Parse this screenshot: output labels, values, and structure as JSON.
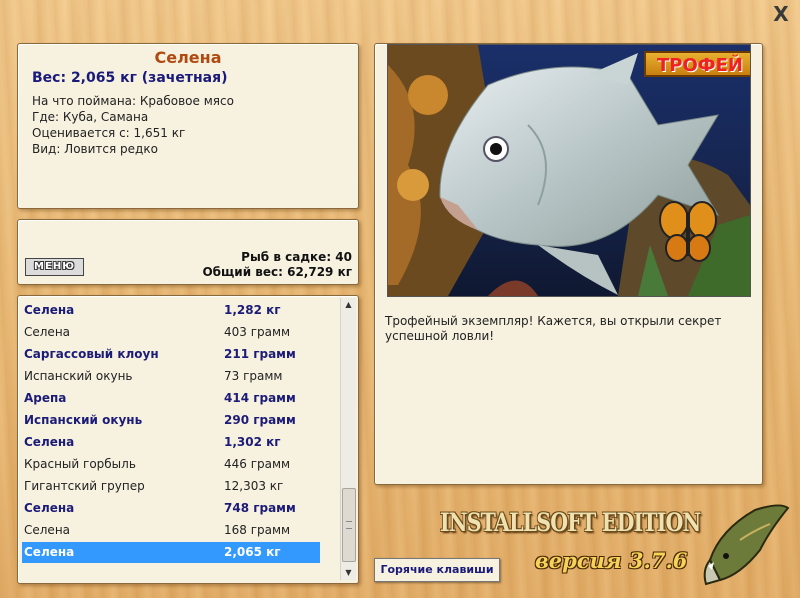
{
  "window": {
    "close_label": "X"
  },
  "info": {
    "name": "Селена",
    "weight": "Вес: 2,065 кг (зачетная)",
    "bait": "На что поймана: Крабовое мясо",
    "place": "Где: Куба, Самана",
    "valued": "Оценивается с: 1,651 кг",
    "kind": "Вид: Ловится редко"
  },
  "middle": {
    "menu_label": "МЕНЮ",
    "keep_count": "Рыб в садке: 40",
    "total_weight": "Общий вес: 62,729 кг"
  },
  "catch_list": [
    {
      "name": "Селена",
      "weight": "1,282 кг",
      "style": "bold"
    },
    {
      "name": "Селена",
      "weight": "403 грамм",
      "style": "regular"
    },
    {
      "name": "Саргассовый клоун",
      "weight": "211 грамм",
      "style": "bold"
    },
    {
      "name": "Испанский окунь",
      "weight": "73 грамм",
      "style": "regular"
    },
    {
      "name": "Арепа",
      "weight": "414 грамм",
      "style": "bold"
    },
    {
      "name": "Испанский окунь",
      "weight": "290 грамм",
      "style": "bold"
    },
    {
      "name": "Селена",
      "weight": "1,302 кг",
      "style": "bold"
    },
    {
      "name": "Красный горбыль",
      "weight": "446 грамм",
      "style": "regular"
    },
    {
      "name": "Гигантский групер",
      "weight": "12,303 кг",
      "style": "regular"
    },
    {
      "name": "Селена",
      "weight": "748 грамм",
      "style": "bold"
    },
    {
      "name": "Селена",
      "weight": "168 грамм",
      "style": "regular"
    },
    {
      "name": "Селена",
      "weight": "2,065 кг",
      "style": "selected"
    }
  ],
  "trophy": {
    "badge": "ТРОФЕЙ",
    "description": "Трофейный экземпляр! Кажется, вы открыли секрет успешной ловли!"
  },
  "footer": {
    "hotkeys_label": "Горячие клавиши",
    "edition": "INSTALLSOFT EDITION",
    "version": "версия 3.7.6"
  },
  "colors": {
    "selection": "#3399ff",
    "bold_text": "#1c1c78",
    "title_text": "#b04a10"
  }
}
